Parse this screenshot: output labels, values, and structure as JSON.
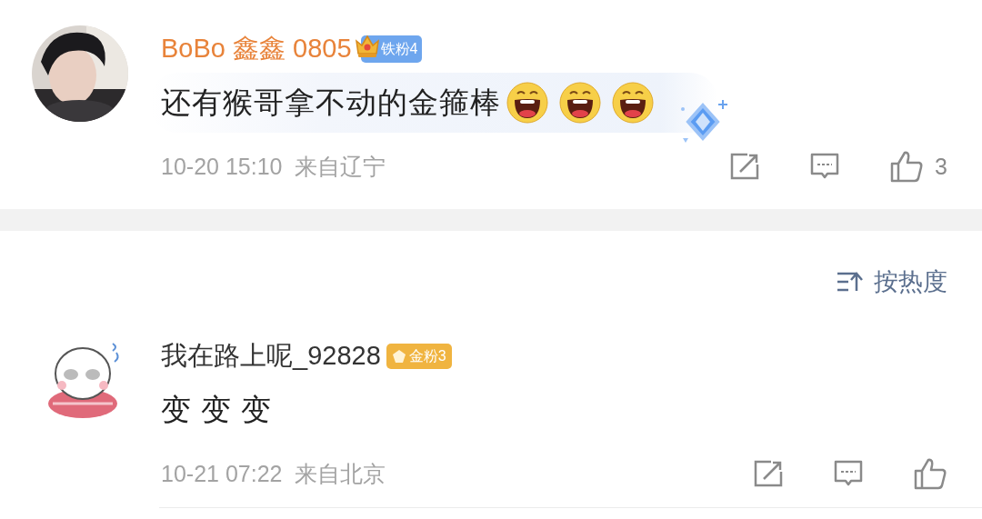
{
  "comments": [
    {
      "username": "BoBo 鑫鑫 0805",
      "vip": true,
      "badge": {
        "kind": "crown",
        "label": "铁粉4",
        "color": "#6ea6ee"
      },
      "text": "还有猴哥拿不动的金箍棒",
      "emojis": [
        {
          "kind": "laugh"
        },
        {
          "kind": "laugh"
        },
        {
          "kind": "laugh"
        }
      ],
      "bubble": true,
      "time": "10-20 15:10",
      "location": "来自辽宁",
      "likes": "3"
    },
    {
      "avatar": {
        "kind": "cartoon"
      },
      "username": "我在路上呢_92828",
      "vip": false,
      "badge": {
        "kind": "gem",
        "label": "金粉3",
        "color": "#f0b440"
      },
      "text": "变 变 变",
      "bubble": false,
      "time": "10-21 07:22",
      "location": "来自北京"
    }
  ],
  "sort": {
    "label": "按热度"
  }
}
